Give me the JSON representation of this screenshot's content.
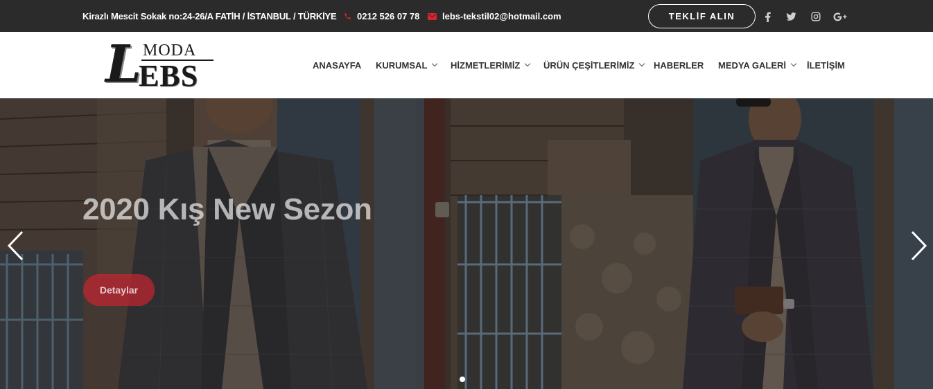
{
  "topbar": {
    "address": "Kirazlı Mescit Sokak no:24-26/A FATİH / İSTANBUL / TÜRKİYE",
    "phone": "0212 526 07 78",
    "email": "lebs-tekstil02@hotmail.com",
    "quote_button": "TEKLİF ALIN",
    "social": [
      {
        "icon": "facebook-icon",
        "glyph": "f"
      },
      {
        "icon": "twitter-icon",
        "glyph": "t"
      },
      {
        "icon": "instagram-icon",
        "glyph": "ig"
      },
      {
        "icon": "google-plus-icon",
        "glyph": "G+"
      }
    ],
    "accent_color": "#d9232d"
  },
  "logo": {
    "big_letter": "L",
    "top_text": "MODA",
    "bottom_text": "EBS"
  },
  "nav": {
    "items": [
      {
        "label": "ANASAYFA",
        "has_dropdown": false
      },
      {
        "label": "KURUMSAL",
        "has_dropdown": true
      },
      {
        "label": "HİZMETLERİMİZ",
        "has_dropdown": true
      },
      {
        "label": "ÜRÜN ÇEŞİTLERİMİZ",
        "has_dropdown": true
      },
      {
        "label": "HABERLER",
        "has_dropdown": false
      },
      {
        "label": "MEDYA GALERİ",
        "has_dropdown": true
      },
      {
        "label": "İLETİŞİM",
        "has_dropdown": false
      }
    ]
  },
  "hero": {
    "title": "2020 Kış New Sezon",
    "button": "Detaylar",
    "button_color": "#c42630",
    "prev_icon": "chevron-left-icon",
    "next_icon": "chevron-right-icon",
    "slides_total": 1,
    "active_slide": 1
  }
}
